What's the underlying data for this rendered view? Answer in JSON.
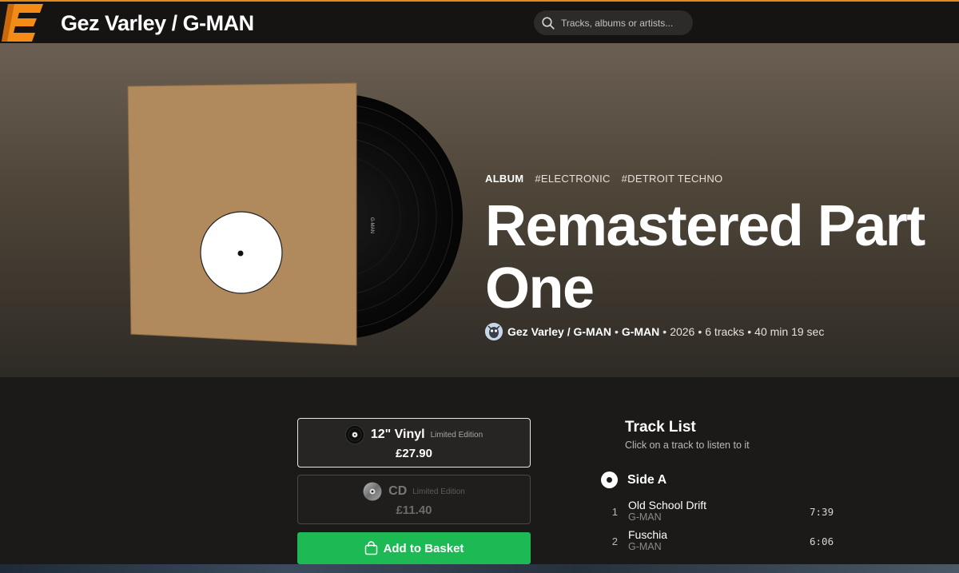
{
  "header": {
    "site_title": "Gez Varley / G-MAN",
    "search_placeholder": "Tracks, albums or artists...",
    "accent_color": "#e08a1e"
  },
  "album": {
    "type_label": "ALBUM",
    "tags": [
      "#ELECTRONIC",
      "#DETROIT TECHNO"
    ],
    "title": "Remastered Part One",
    "artist": "Gez Varley / G-MAN",
    "label": "G-MAN",
    "year": "2026",
    "track_count": "6 tracks",
    "duration": "40 min 19 sec",
    "cover_label_text": "G-MAN"
  },
  "formats": [
    {
      "name": "12\" Vinyl",
      "note": "Limited Edition",
      "price": "£27.90",
      "icon": "vinyl-record-icon",
      "selected": true
    },
    {
      "name": "CD",
      "note": "Limited Edition",
      "price": "£11.40",
      "icon": "cd-icon",
      "selected": false
    }
  ],
  "basket": {
    "label": "Add to Basket",
    "color": "#1db954"
  },
  "tracklist": {
    "title": "Track List",
    "subtitle": "Click on a track to listen to it",
    "side_label": "Side A",
    "tracks": [
      {
        "num": "1",
        "title": "Old School Drift",
        "artist": "G-MAN",
        "duration": "7:39"
      },
      {
        "num": "2",
        "title": "Fuschia",
        "artist": "G-MAN",
        "duration": "6:06"
      }
    ]
  }
}
